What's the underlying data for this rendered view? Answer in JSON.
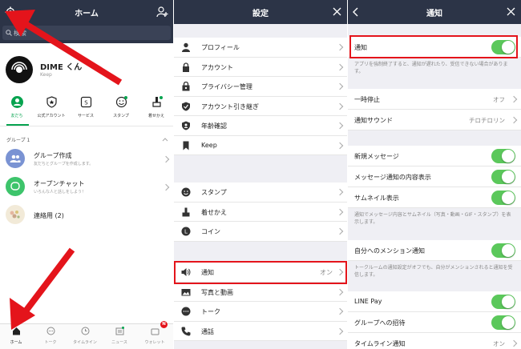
{
  "home": {
    "title": "ホーム",
    "search_placeholder": "検索",
    "profile": {
      "name": "DIME くん",
      "status": "Keep"
    },
    "tabs": [
      "友だち",
      "公式アカウント",
      "サービス",
      "スタンプ",
      "着せかえ"
    ],
    "group_header": "グループ 1",
    "rows": [
      {
        "name": "グループ作成",
        "sub": "友だちとグループを作成します。"
      },
      {
        "name": "オープンチャット",
        "sub": "いろんな人と話しをしよう！"
      },
      {
        "name": "連絡用 (2)",
        "sub": ""
      }
    ],
    "bottom_nav": [
      "ホーム",
      "トーク",
      "タイムライン",
      "ニュース",
      "ウォレット"
    ],
    "wallet_badge": "N",
    "accent": "#06a34f"
  },
  "settings": {
    "title": "設定",
    "group1": [
      "プロフィール",
      "アカウント",
      "プライバシー管理",
      "アカウント引き継ぎ",
      "年齢確認",
      "Keep"
    ],
    "group2": [
      "スタンプ",
      "着せかえ",
      "コイン"
    ],
    "group3": [
      {
        "label": "通知",
        "value": "オン"
      },
      {
        "label": "写真と動画",
        "value": ""
      },
      {
        "label": "トーク",
        "value": ""
      },
      {
        "label": "通話",
        "value": ""
      }
    ]
  },
  "notify": {
    "title": "通知",
    "main_label": "通知",
    "main_note": "アプリを強制終了すると、通知が遅れたり、受信できない場合があります。",
    "rows_a": [
      {
        "label": "一時停止",
        "value": "オフ"
      },
      {
        "label": "通知サウンド",
        "value": "チロチロリン"
      }
    ],
    "rows_b": [
      "新規メッセージ",
      "メッセージ通知の内容表示",
      "サムネイル表示"
    ],
    "note_b": "通知でメッセージ内容とサムネイル（写真・動画・GIF・スタンプ）を表示します。",
    "mention_label": "自分へのメンション通知",
    "mention_note": "トークルームの通知設定がオフでも、自分がメンションされると通知を受信します。",
    "rows_c": [
      "LINE Pay",
      "グループへの招待"
    ],
    "timeline_row": {
      "label": "タイムライン通知",
      "value": "オン"
    },
    "toggle_color": "#5bc85b"
  },
  "annotation_color": "#e4141b"
}
